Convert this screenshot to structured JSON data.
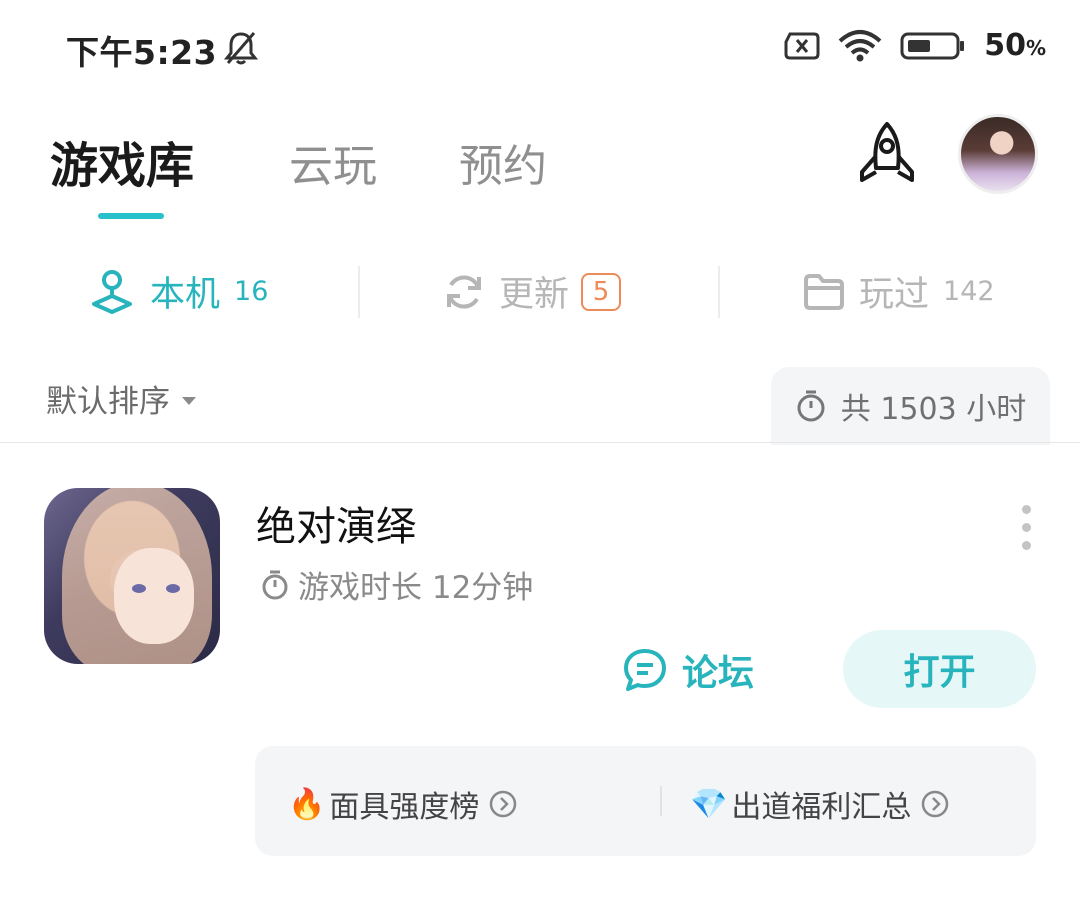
{
  "status_bar": {
    "time": "下午5:23",
    "icons": [
      "mute-bell-icon",
      "no-sim-icon",
      "wifi-icon",
      "battery-icon"
    ],
    "battery_value": "50",
    "battery_unit": "%"
  },
  "header": {
    "tabs": [
      {
        "label": "游戏库",
        "active": true
      },
      {
        "label": "云玩",
        "active": false
      },
      {
        "label": "预约",
        "active": false
      }
    ],
    "rocket_icon": "rocket-icon",
    "avatar": "user-avatar"
  },
  "subtabs": [
    {
      "label": "本机",
      "count": "16",
      "icon": "joystick-icon",
      "active": true
    },
    {
      "label": "更新",
      "count": "5",
      "icon": "refresh-icon",
      "active": false
    },
    {
      "label": "玩过",
      "count": "142",
      "icon": "folder-icon",
      "active": false
    }
  ],
  "sort": {
    "label": "默认排序"
  },
  "total_time": {
    "text": "共 1503 小时"
  },
  "game": {
    "title": "绝对演绎",
    "playtime": "游戏时长 12分钟",
    "forum_label": "论坛",
    "open_label": "打开"
  },
  "links": [
    {
      "emoji": "🔥",
      "label": "面具强度榜"
    },
    {
      "emoji": "💎",
      "label": "出道福利汇总"
    }
  ],
  "colors": {
    "accent": "#27c1c9",
    "badge": "#ee8a5a",
    "card_bg": "#f4f5f7"
  }
}
